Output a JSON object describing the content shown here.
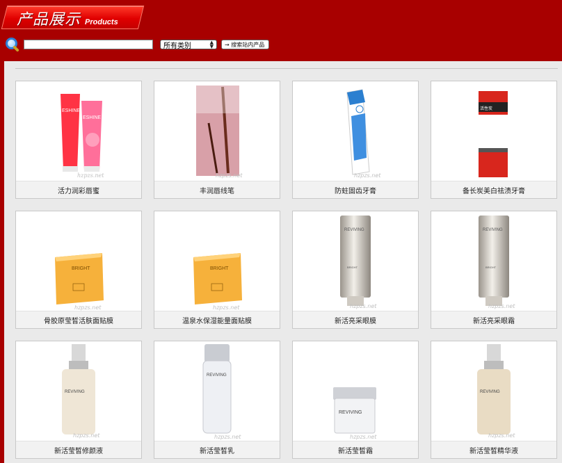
{
  "header": {
    "title_cn": "产品展示",
    "title_en": "Products"
  },
  "search": {
    "icon": "magnifier-icon",
    "input_value": "",
    "category_selected": "所有类别",
    "button_label": "→ 搜索站内产品"
  },
  "watermark": "hzpzs.net",
  "products": [
    {
      "name": "活力润彩唇蜜",
      "image": "lip-gloss-tubes"
    },
    {
      "name": "丰润唇线笔",
      "image": "lip-liner-pencil"
    },
    {
      "name": "防蛀固齿牙膏",
      "image": "toothpaste-blue-box"
    },
    {
      "name": "备长炭美白祛渍牙膏",
      "image": "toothpaste-red-box"
    },
    {
      "name": "骨胶原莹皙活肤面贴膜",
      "image": "bright-mask-pack"
    },
    {
      "name": "温泉水保湿能量面贴膜",
      "image": "bright-mask-pack"
    },
    {
      "name": "新活亮采眼膜",
      "image": "reviving-tube"
    },
    {
      "name": "新活亮采眼霜",
      "image": "reviving-tube"
    },
    {
      "name": "新活莹皙修颜液",
      "image": "reviving-pump-bottle"
    },
    {
      "name": "新活莹皙乳",
      "image": "reviving-lotion-bottle"
    },
    {
      "name": "新活莹皙霜",
      "image": "reviving-cream-jar"
    },
    {
      "name": "新活莹皙精华液",
      "image": "reviving-pump-bottle"
    }
  ]
}
